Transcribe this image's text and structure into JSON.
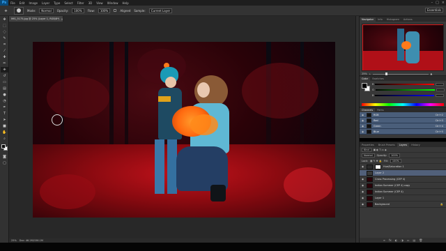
{
  "app": {
    "logo": "Ps"
  },
  "menubar": {
    "items": [
      "File",
      "Edit",
      "Image",
      "Layer",
      "Type",
      "Select",
      "Filter",
      "3D",
      "View",
      "Window",
      "Help"
    ],
    "controls": [
      "–",
      "□",
      "×"
    ]
  },
  "options": {
    "mode_label": "Mode:",
    "mode_value": "Normal",
    "opacity_label": "Opacity:",
    "opacity_value": "100%",
    "flow_label": "Flow:",
    "flow_value": "100%",
    "aligned_label": "Aligned",
    "sample_label": "Sample:",
    "sample_value": "Current Layer",
    "workspace_value": "Essentials"
  },
  "document": {
    "tab_title": "IMG_5175.jpg @ 25% (Layer 1, RGB/8*)",
    "tab_close": "×"
  },
  "status": {
    "zoom": "25%",
    "doc_size": "Doc: 46.2M/156.1M"
  },
  "navigator": {
    "tabs": [
      "Navigator",
      "Info",
      "Histogram",
      "Actions"
    ],
    "zoom": "25%"
  },
  "color": {
    "tabs": [
      "Color",
      "Swatches"
    ],
    "channels": [
      "R",
      "G",
      "B"
    ]
  },
  "channels": {
    "tabs": [
      "Channels",
      "Paths"
    ],
    "rows": [
      {
        "name": "RGB",
        "shortcut": "Ctrl+2"
      },
      {
        "name": "Red",
        "shortcut": "Ctrl+3"
      },
      {
        "name": "Green",
        "shortcut": "Ctrl+4"
      },
      {
        "name": "Blue",
        "shortcut": "Ctrl+5"
      }
    ]
  },
  "layers": {
    "tabs": [
      "Properties",
      "Brush Presets",
      "Layers",
      "History"
    ],
    "kind": "Kind",
    "blend": "Normal",
    "opacity_label": "Opacity:",
    "opacity_value": "100%",
    "lock_label": "Lock:",
    "fill_label": "Fill:",
    "fill_value": "100%",
    "rows": [
      {
        "name": "Hue/Saturation 1",
        "mask": true
      },
      {
        "name": "Layer 2",
        "mask": false
      },
      {
        "name": "Cross Processing (CEP 4)",
        "mask": false
      },
      {
        "name": "Indian Summer (CEP 4) copy",
        "mask": false
      },
      {
        "name": "Indian Summer (CEP 4)",
        "mask": false
      },
      {
        "name": "Layer 1",
        "mask": false
      },
      {
        "name": "Background",
        "mask": false
      }
    ],
    "footer": [
      "∞",
      "fx",
      "◐",
      "◑",
      "▭",
      "▤",
      "🗑"
    ]
  }
}
